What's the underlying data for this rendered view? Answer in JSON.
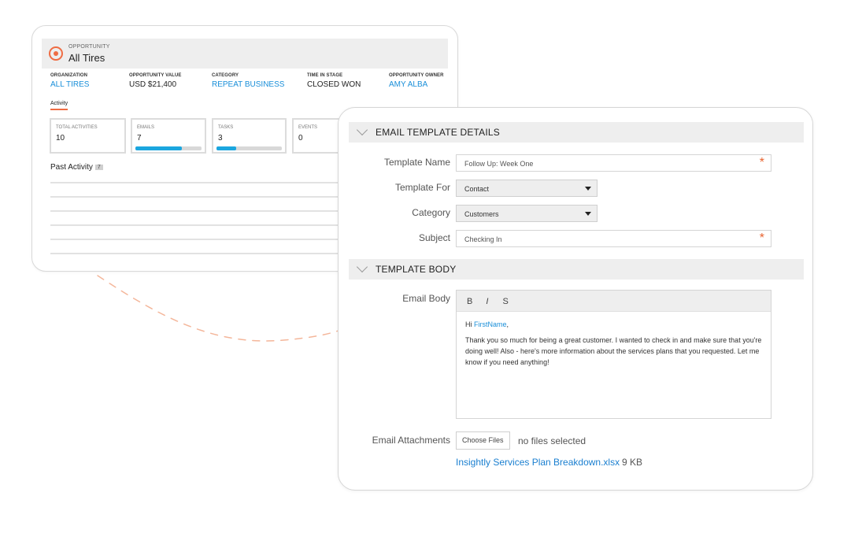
{
  "opportunity": {
    "kicker": "OPPORTUNITY",
    "title": "All Tires",
    "fields": [
      {
        "label": "ORGANIZATION",
        "value": "ALL TIRES"
      },
      {
        "label": "OPPORTUNITY VALUE",
        "value": "USD $21,400"
      },
      {
        "label": "CATEGORY",
        "value": "REPEAT BUSINESS"
      },
      {
        "label": "TIME IN STAGE",
        "value": "CLOSED WON"
      },
      {
        "label": "OPPORTUNITY OWNER",
        "value": "AMY ALBA"
      }
    ],
    "activity_tab": "Activity",
    "stats": [
      {
        "label": "TOTAL ACTIVITIES",
        "value": "10"
      },
      {
        "label": "EMAILS",
        "value": "7",
        "progress": 0.7
      },
      {
        "label": "TASKS",
        "value": "3",
        "progress": 0.3
      },
      {
        "label": "EVENTS",
        "value": "0"
      }
    ],
    "past_activity": "Past Activity",
    "past_count": "7",
    "accent": "#ef6c43",
    "link_color": "#1a8fd9"
  },
  "template": {
    "details_title": "EMAIL TEMPLATE DETAILS",
    "name_label": "Template Name",
    "name_value": "Follow Up: Week One",
    "for_label": "Template For",
    "for_value": "Contact",
    "category_label": "Category",
    "category_value": "Customers",
    "subject_label": "Subject",
    "subject_value": "Checking In",
    "required_mark": "*",
    "body_title": "TEMPLATE BODY",
    "email_body_label": "Email Body",
    "toolbar": {
      "bold": "B",
      "italic": "I",
      "strike": "S"
    },
    "greeting": "Hi",
    "merge_field": "FirstName",
    "greeting_suffix": ",",
    "body": "Thank you so much for being a great customer. I wanted to check in and make sure that you're doing well! Also - here's more information about the services plans that you requested. Let me know if you need anything!",
    "attachments_label": "Email Attachments",
    "choose_files": "Choose Files",
    "no_files": "no files selected",
    "attachment_name": "Insightly Services Plan Breakdown.xlsx",
    "attachment_size": "9 KB"
  },
  "icons": [
    "target-icon",
    "chevron-down-icon",
    "caret-down-icon",
    "required-asterisk"
  ]
}
